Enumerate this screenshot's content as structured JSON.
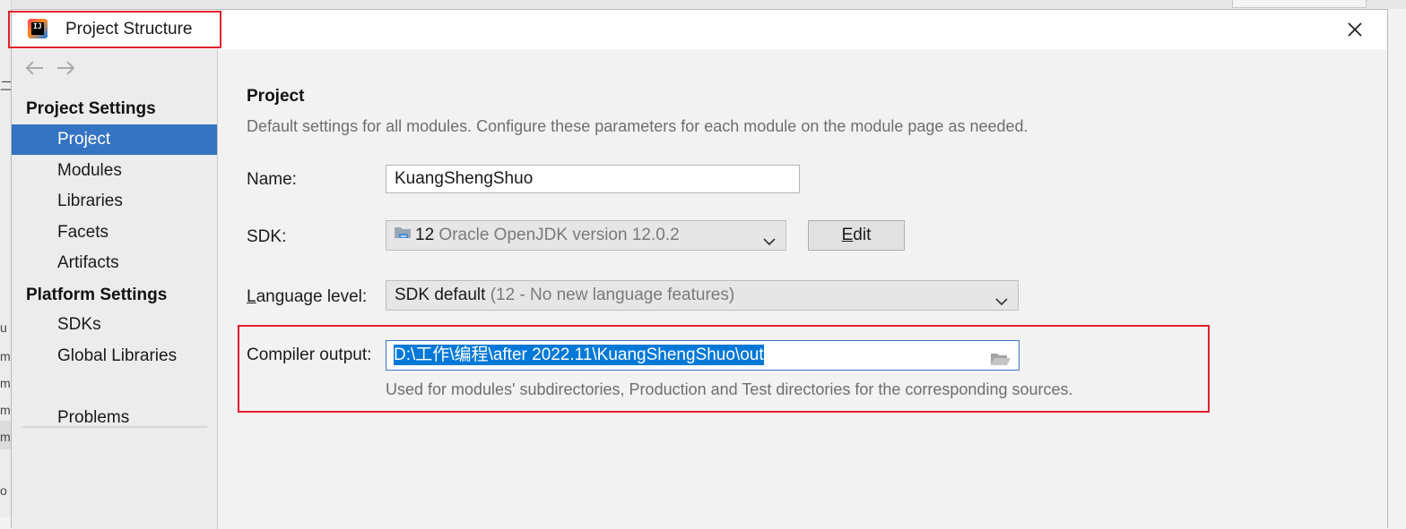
{
  "window": {
    "title": "Project Structure",
    "close_glyph": "✕"
  },
  "sidebar": {
    "project_settings_title": "Project Settings",
    "project_items": [
      {
        "label": "Project",
        "selected": true
      },
      {
        "label": "Modules",
        "selected": false
      },
      {
        "label": "Libraries",
        "selected": false
      },
      {
        "label": "Facets",
        "selected": false
      },
      {
        "label": "Artifacts",
        "selected": false
      }
    ],
    "platform_settings_title": "Platform Settings",
    "platform_items": [
      {
        "label": "SDKs"
      },
      {
        "label": "Global Libraries"
      }
    ],
    "problems_label": "Problems"
  },
  "main": {
    "heading": "Project",
    "description": "Default settings for all modules. Configure these parameters for each module on the module page as needed.",
    "name_label": "Name:",
    "name_value": "KuangShengShuo",
    "sdk_label": "SDK:",
    "sdk_version": "12",
    "sdk_name": "Oracle OpenJDK version 12.0.2",
    "edit_button_rest": "dit",
    "language_level_label_rest": "anguage level:",
    "language_level_value": "SDK default",
    "language_level_detail": "(12 - No new language features)",
    "compiler_output_label": "Compiler output:",
    "compiler_output_value": "D:\\工作\\编程\\after 2022.11\\KuangShengShuo\\out",
    "compiler_output_hint": "Used for modules' subdirectories, Production and Test directories for the corresponding sources."
  },
  "background": {
    "left_strip_letters": [
      "二",
      "u",
      "m",
      "m",
      "m",
      "m",
      "o"
    ]
  },
  "colors": {
    "selection": "#3574c2",
    "highlight_box": "#e0202c",
    "text_selection": "#0078d7"
  }
}
